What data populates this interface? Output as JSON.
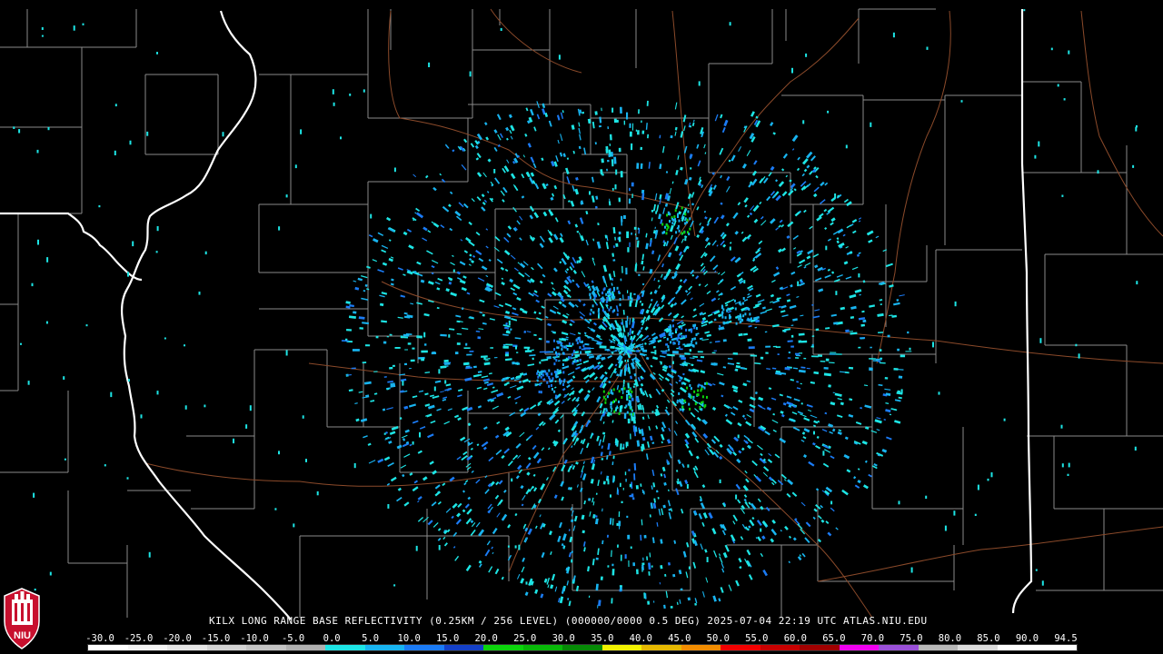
{
  "map": {
    "caption": "KILX LONG RANGE BASE REFLECTIVITY (0.25KM / 256 LEVEL) (000000/0000 0.5 DEG) 2025-07-04 22:19 UTC  ATLAS.NIU.EDU",
    "logo_text": "NIU",
    "colors": {
      "background": "#000000",
      "state_border": "#ffffff",
      "county_border": "#8a8a8a",
      "highway": "#8b4a2a"
    },
    "legend": {
      "labels": [
        "-30.0",
        "-25.0",
        "-20.0",
        "-15.0",
        "-10.0",
        "-5.0",
        "0.0",
        "5.0",
        "10.0",
        "15.0",
        "20.0",
        "25.0",
        "30.0",
        "35.0",
        "40.0",
        "45.0",
        "50.0",
        "55.0",
        "60.0",
        "65.0",
        "70.0",
        "75.0",
        "80.0",
        "85.0",
        "90.0",
        "94.5"
      ],
      "colors": [
        "#ffffff",
        "#f4f4f4",
        "#e6e6e6",
        "#d4d4d4",
        "#c4c4c4",
        "#b0b0b0",
        "#1de5e5",
        "#18b4f0",
        "#1b7bf5",
        "#1440c8",
        "#0cd40c",
        "#08b808",
        "#068a06",
        "#f2f200",
        "#e6b800",
        "#f28c00",
        "#f20000",
        "#c80000",
        "#a00000",
        "#f000f0",
        "#9a50d8",
        "#b8b8b8",
        "#dcdcdc",
        "#ffffff",
        "#ffffff"
      ]
    }
  }
}
